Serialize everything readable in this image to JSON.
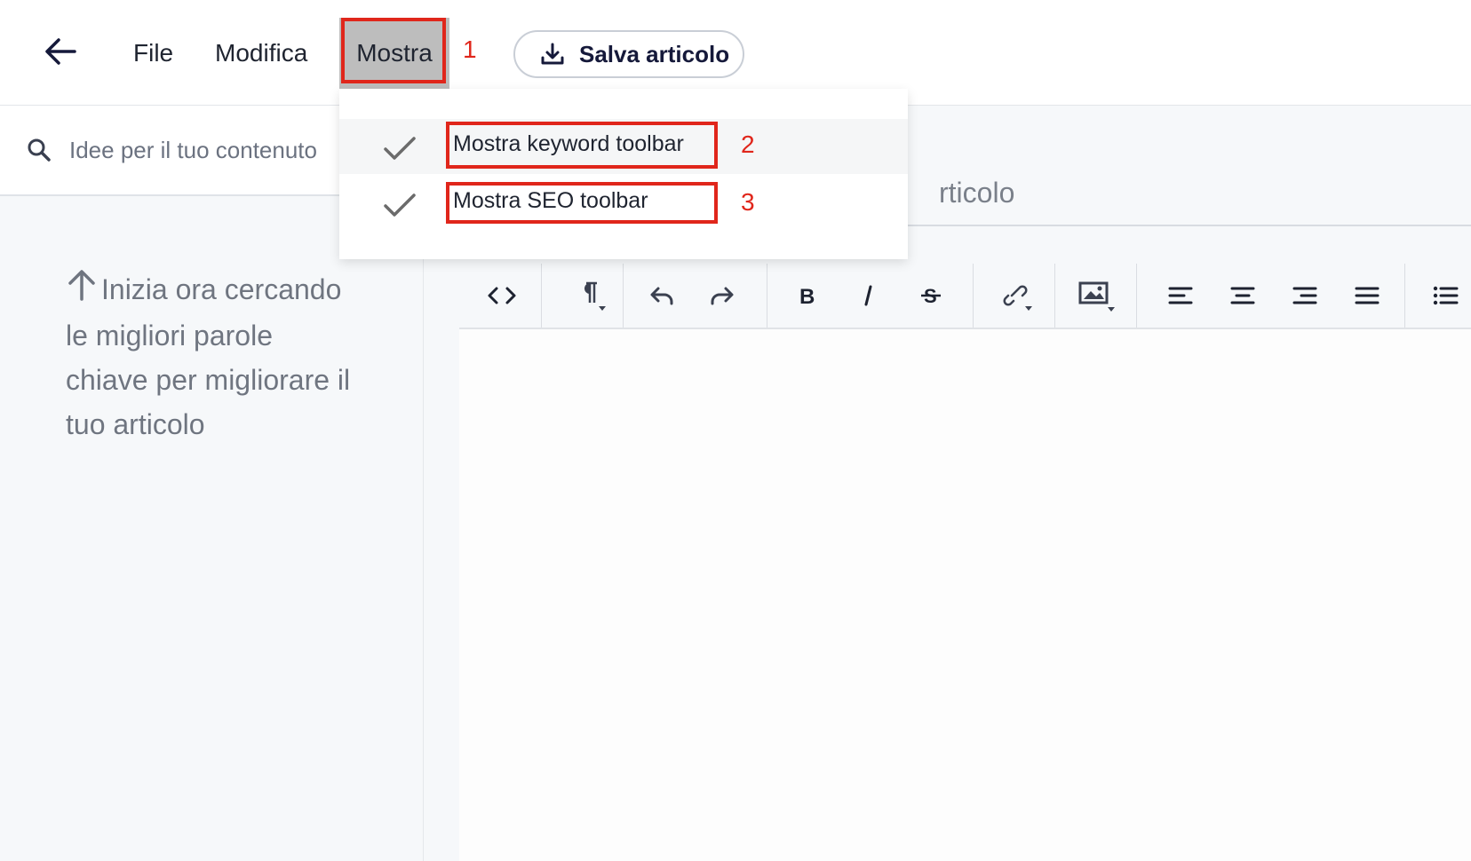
{
  "menu": {
    "file": "File",
    "modifica": "Modifica",
    "mostra": "Mostra"
  },
  "save_button": {
    "label": "Salva articolo",
    "icon": "download-icon"
  },
  "dropdown": {
    "items": [
      {
        "label": "Mostra keyword toolbar",
        "checked": true
      },
      {
        "label": "Mostra SEO toolbar",
        "checked": true
      }
    ]
  },
  "annotations": {
    "step1": "1",
    "step2": "2",
    "step3": "3",
    "highlight_color": "#e0261b"
  },
  "search": {
    "placeholder": "Idee per il tuo contenuto"
  },
  "sidebar": {
    "hint": "Inizia ora cercando le migliori parole chiave per migliorare il tuo articolo"
  },
  "editor": {
    "title_fragment": "rticolo",
    "toolbar_icons": [
      "code-view-icon",
      "paragraph-icon",
      "undo-icon",
      "redo-icon",
      "bold-icon",
      "italic-icon",
      "strikethrough-icon",
      "link-icon",
      "image-icon",
      "align-left-icon",
      "align-center-icon",
      "align-right-icon",
      "align-justify-icon",
      "bullet-list-icon"
    ]
  }
}
